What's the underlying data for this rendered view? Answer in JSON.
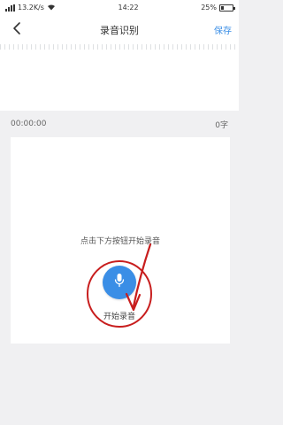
{
  "status_bar": {
    "speed": "13.2K/s",
    "time": "14:22",
    "battery": "25%"
  },
  "nav": {
    "title": "录音识别",
    "save_label": "保存"
  },
  "recording": {
    "duration": "00:00:00",
    "char_count": "0字",
    "hint": "点击下方按钮开始录音",
    "start_label": "开始录音"
  },
  "colors": {
    "accent": "#3a8ee6",
    "annotation": "#c81e1e"
  }
}
